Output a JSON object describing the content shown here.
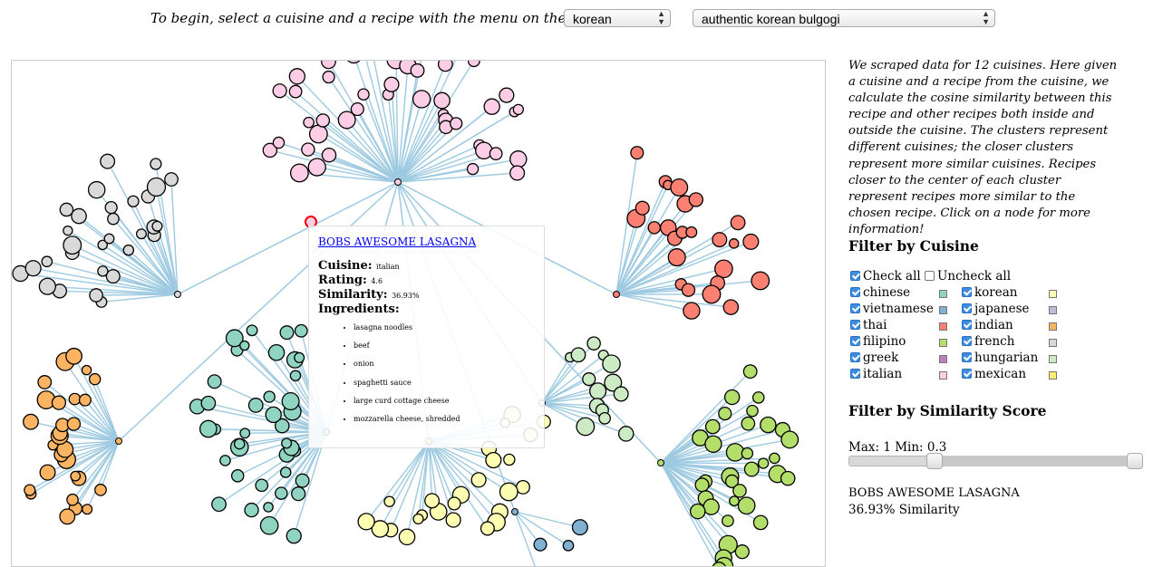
{
  "header": {
    "instruction": "To begin, select a cuisine and a recipe with the menu on the right -->",
    "cuisine_value": "korean",
    "recipe_value": "authentic korean bulgogi"
  },
  "sidebar": {
    "description": "We scraped data for 12 cuisines. Here given a cuisine and a recipe from the cuisine, we calculate the cosine similarity between this recipe and other recipes both inside and outside the cuisine. The clusters represent different cuisines; the closer clusters represent more similar cuisines. Recipes closer to the center of each cluster represent recipes more similar to the chosen recipe. Click on a node for more information!",
    "filter_cuisine_title": "Filter by Cuisine",
    "check_all_label": "Check all",
    "uncheck_all_label": "Uncheck all",
    "cuisines": [
      {
        "label": "chinese",
        "color": "#8fd4c1",
        "checked": true
      },
      {
        "label": "korean",
        "color": "#ffffb3",
        "checked": true
      },
      {
        "label": "vietnamese",
        "color": "#80b1d3",
        "checked": true
      },
      {
        "label": "japanese",
        "color": "#bebada",
        "checked": true
      },
      {
        "label": "thai",
        "color": "#fb8072",
        "checked": true
      },
      {
        "label": "indian",
        "color": "#fdb462",
        "checked": true
      },
      {
        "label": "filipino",
        "color": "#b3de69",
        "checked": true
      },
      {
        "label": "french",
        "color": "#d9d9d9",
        "checked": true
      },
      {
        "label": "greek",
        "color": "#bc80bd",
        "checked": true
      },
      {
        "label": "hungarian",
        "color": "#ccebc5",
        "checked": true
      },
      {
        "label": "italian",
        "color": "#fccde5",
        "checked": true
      },
      {
        "label": "mexican",
        "color": "#ffed6f",
        "checked": true
      }
    ],
    "filter_similarity_title": "Filter by Similarity Score",
    "similarity_range_text": "Max: 1 Min: 0.3",
    "similarity_min": 0.3,
    "similarity_max": 1,
    "selected_name": "BOBS AWESOME LASAGNA",
    "selected_similarity": "36.93% Similarity"
  },
  "tooltip": {
    "title": "BOBS AWESOME LASAGNA",
    "cuisine_label": "Cuisine:",
    "cuisine_value": "italian",
    "rating_label": "Rating:",
    "rating_value": "4.6",
    "similarity_label": "Similarity:",
    "similarity_value": "36.93%",
    "ingredients_label": "Ingredients:",
    "ingredients": [
      "lasagna noodles",
      "beef",
      "onion",
      "spaghetti sauce",
      "large curd cottage cheese",
      "mozzarella cheese, shredded"
    ]
  },
  "graph": {
    "edge_color": "#9ecae1",
    "clusters": [
      {
        "cuisine": "italian",
        "color": "#fccde5",
        "nodes": 45
      },
      {
        "cuisine": "french",
        "color": "#d9d9d9",
        "nodes": 30
      },
      {
        "cuisine": "thai",
        "color": "#fb8072",
        "nodes": 26
      },
      {
        "cuisine": "chinese",
        "color": "#8fd4c1",
        "nodes": 40
      },
      {
        "cuisine": "korean",
        "color": "#ffffb3",
        "nodes": 25
      },
      {
        "cuisine": "hungarian",
        "color": "#ccebc5",
        "nodes": 14
      },
      {
        "cuisine": "indian",
        "color": "#fdb462",
        "nodes": 28
      },
      {
        "cuisine": "filipino",
        "color": "#b3de69",
        "nodes": 36
      },
      {
        "cuisine": "vietnamese",
        "color": "#80b1d3",
        "nodes": 4
      }
    ]
  }
}
